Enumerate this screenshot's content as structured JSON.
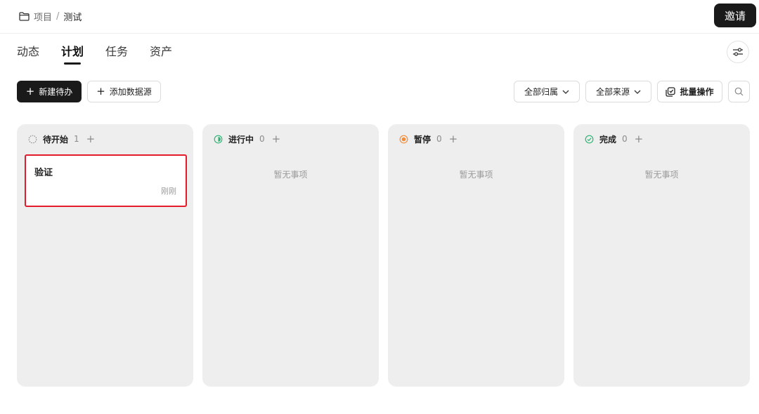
{
  "breadcrumb": {
    "project": "项目",
    "separator": "/",
    "current": "测试"
  },
  "header": {
    "invite_label": "邀请"
  },
  "tabs": [
    {
      "label": "动态",
      "active": false
    },
    {
      "label": "计划",
      "active": true
    },
    {
      "label": "任务",
      "active": false
    },
    {
      "label": "资产",
      "active": false
    }
  ],
  "toolbar": {
    "new_todo_label": "新建待办",
    "add_datasource_label": "添加数据源",
    "owner_filter_label": "全部归属",
    "source_filter_label": "全部来源",
    "batch_label": "批量操作"
  },
  "columns": [
    {
      "title": "待开始",
      "count": "1",
      "add": "+",
      "empty_text": ""
    },
    {
      "title": "进行中",
      "count": "0",
      "add": "+",
      "empty_text": "暂无事项"
    },
    {
      "title": "暂停",
      "count": "0",
      "add": "+",
      "empty_text": "暂无事项"
    },
    {
      "title": "完成",
      "count": "0",
      "add": "+",
      "empty_text": "暂无事项"
    }
  ],
  "cards": [
    {
      "title": "验证",
      "time": "刚刚"
    }
  ],
  "colors": {
    "primary": "#1a1a1a",
    "in_progress": "#2bb673",
    "paused": "#f08c3a",
    "done": "#2bb673",
    "selected_border": "#e31b2a"
  },
  "icons": {
    "breadcrumb": "folder-icon",
    "settings": "sliders-icon",
    "batch": "batch-select-icon",
    "search": "search-icon"
  }
}
